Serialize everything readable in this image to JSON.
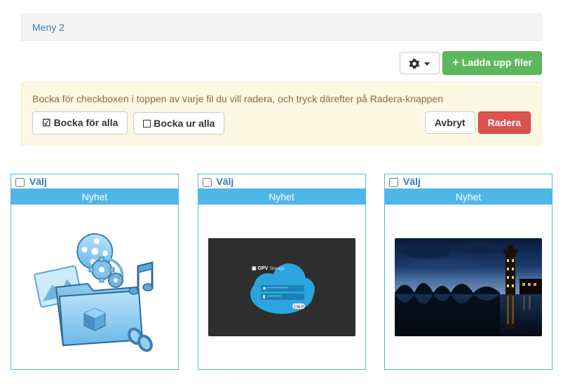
{
  "menu": {
    "item": "Meny 2"
  },
  "toolbar": {
    "upload_label": "Ladda upp filer"
  },
  "alert": {
    "message": "Bocka för checkboxen i toppen av varje fil du vill radera, och tryck därefter på Radera-knappen",
    "check_all": "Bocka för alla",
    "uncheck_all": "Bocka ur alla",
    "cancel": "Avbryt",
    "delete": "Radera"
  },
  "cards": [
    {
      "select_label": "Välj",
      "tag": "Nyhet"
    },
    {
      "select_label": "Välj",
      "tag": "Nyhet"
    },
    {
      "select_label": "Välj",
      "tag": "Nyhet"
    }
  ]
}
